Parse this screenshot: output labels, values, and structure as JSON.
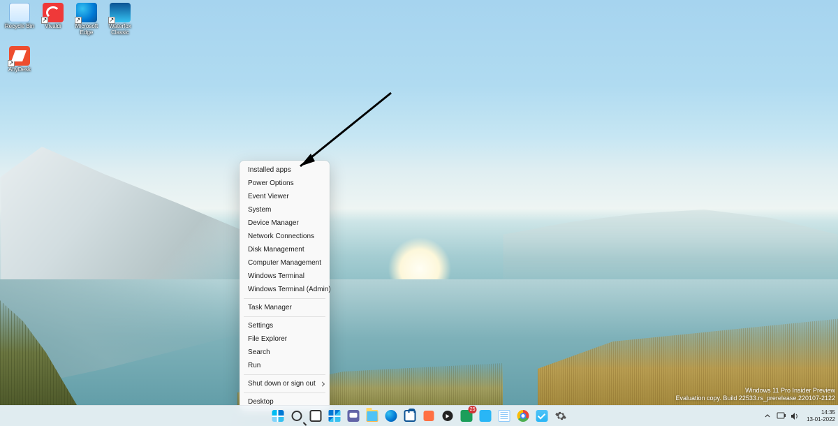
{
  "desktop_icons": [
    {
      "id": "recycle-bin",
      "label": "Recycle Bin"
    },
    {
      "id": "vivaldi",
      "label": "Vivaldi"
    },
    {
      "id": "edge",
      "label": "Microsoft Edge"
    },
    {
      "id": "waterfox",
      "label": "Waterfox Classic"
    },
    {
      "id": "anydesk",
      "label": "AnyDesk"
    }
  ],
  "context_menu": {
    "groups": [
      [
        "Installed apps",
        "Power Options",
        "Event Viewer",
        "System",
        "Device Manager",
        "Network Connections",
        "Disk Management",
        "Computer Management",
        "Windows Terminal",
        "Windows Terminal (Admin)"
      ],
      [
        "Task Manager"
      ],
      [
        "Settings",
        "File Explorer",
        "Search",
        "Run"
      ],
      [
        "Shut down or sign out"
      ],
      [
        "Desktop"
      ]
    ],
    "submenu_item": "Shut down or sign out"
  },
  "watermark": {
    "line1": "Windows 11 Pro Insider Preview",
    "line2": "Evaluation copy. Build 22533.rs_prerelease.220107-2122"
  },
  "taskbar": {
    "pinned": [
      {
        "id": "start",
        "name": "Start"
      },
      {
        "id": "search",
        "name": "Search"
      },
      {
        "id": "taskview",
        "name": "Task view"
      },
      {
        "id": "widgets",
        "name": "Widgets"
      },
      {
        "id": "chat",
        "name": "Chat"
      },
      {
        "id": "explorer",
        "name": "File Explorer"
      },
      {
        "id": "edge",
        "name": "Microsoft Edge"
      },
      {
        "id": "store",
        "name": "Microsoft Store"
      },
      {
        "id": "app-orange",
        "name": "App"
      },
      {
        "id": "media",
        "name": "Media"
      },
      {
        "id": "app-green",
        "name": "App",
        "badge": "25"
      },
      {
        "id": "app-blue",
        "name": "App"
      },
      {
        "id": "notepad",
        "name": "Editor"
      },
      {
        "id": "chrome",
        "name": "Chrome"
      },
      {
        "id": "todo",
        "name": "To Do"
      },
      {
        "id": "settings",
        "name": "Settings"
      }
    ],
    "tray": {
      "time": "14:35",
      "date": "13-01-2022"
    }
  }
}
